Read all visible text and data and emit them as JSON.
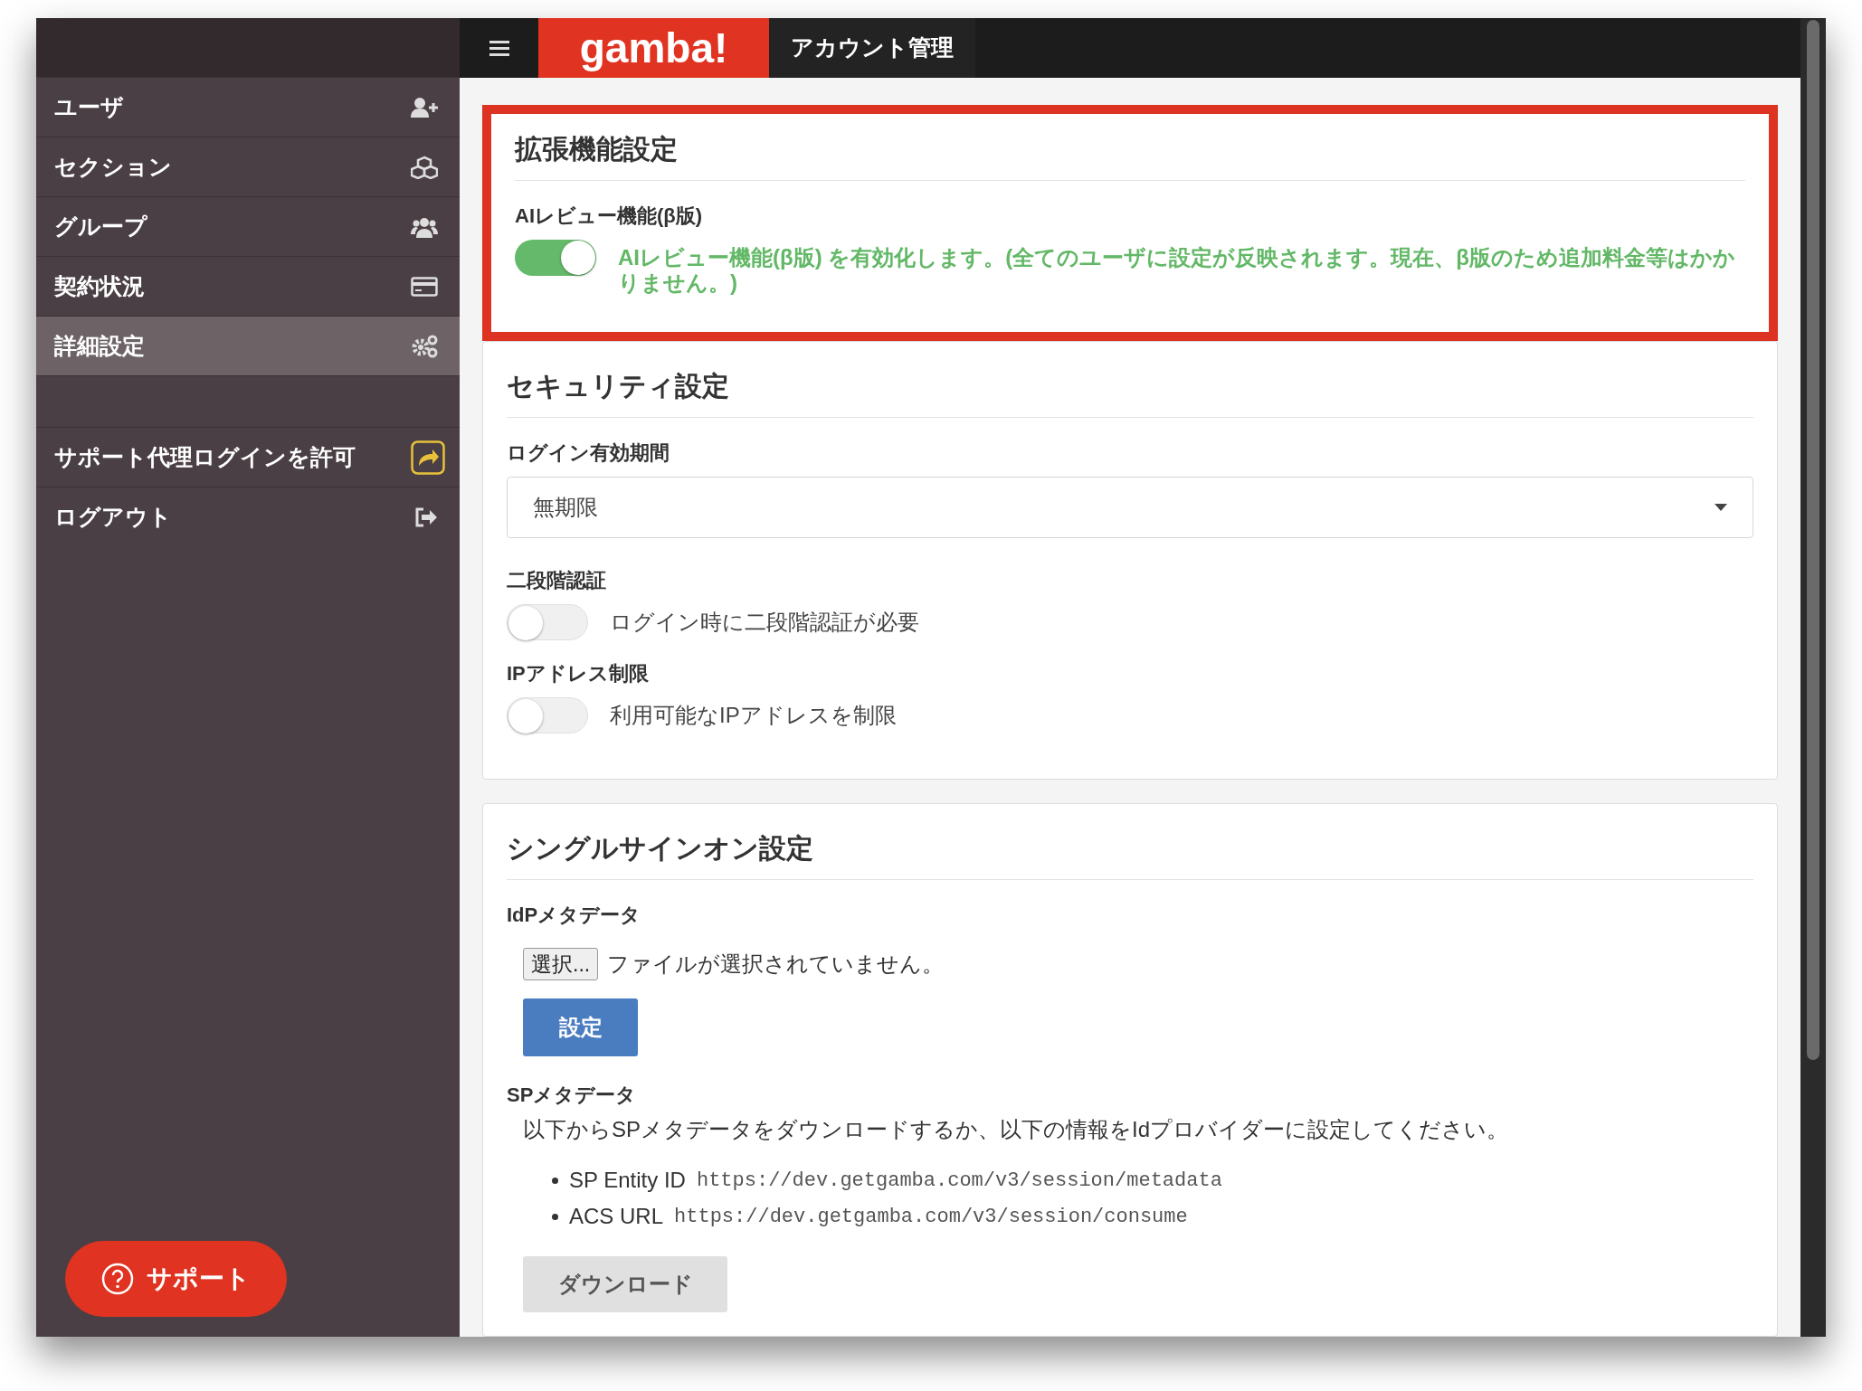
{
  "header": {
    "logo": "gamba!",
    "title": "アカウント管理"
  },
  "sidebar": {
    "items": [
      {
        "label": "ユーザ",
        "selected": false
      },
      {
        "label": "セクション",
        "selected": false
      },
      {
        "label": "グループ",
        "selected": false
      },
      {
        "label": "契約状況",
        "selected": false
      },
      {
        "label": "詳細設定",
        "selected": true
      }
    ],
    "extra_items": [
      {
        "label": "サポート代理ログインを許可"
      },
      {
        "label": "ログアウト"
      }
    ],
    "support_button": "サポート"
  },
  "sections": [
    {
      "title": "拡張機能設定",
      "highlighted": true,
      "fields": [
        {
          "kind": "toggle",
          "label": "AIレビュー機能(β版)",
          "on": true,
          "text": "AIレビュー機能(β版) を有効化します。(全てのユーザに設定が反映されます。現在、β版のため追加料金等はかかりません。)"
        }
      ]
    },
    {
      "title": "セキュリティ設定",
      "highlighted": false,
      "fields": [
        {
          "kind": "select",
          "label": "ログイン有効期間",
          "value": "無期限"
        },
        {
          "kind": "toggle",
          "label": "二段階認証",
          "on": false,
          "text": "ログイン時に二段階認証が必要"
        },
        {
          "kind": "toggle",
          "label": "IPアドレス制限",
          "on": false,
          "text": "利用可能なIPアドレスを制限"
        }
      ]
    },
    {
      "title": "シングルサインオン設定",
      "highlighted": false,
      "fields": [
        {
          "kind": "file",
          "label": "IdPメタデータ",
          "button": "選択...",
          "status": "ファイルが選択されていません。"
        },
        {
          "kind": "primary_button",
          "text": "設定"
        },
        {
          "kind": "metadata",
          "label": "SPメタデータ",
          "description": "以下からSPメタデータをダウンロードするか、以下の情報をIdプロバイダーに設定してください。",
          "items": [
            {
              "term": "SP Entity ID",
              "url": "https://dev.getgamba.com/v3/session/metadata"
            },
            {
              "term": "ACS URL",
              "url": "https://dev.getgamba.com/v3/session/consume"
            }
          ]
        },
        {
          "kind": "secondary_button",
          "text": "ダウンロード"
        }
      ]
    }
  ]
}
